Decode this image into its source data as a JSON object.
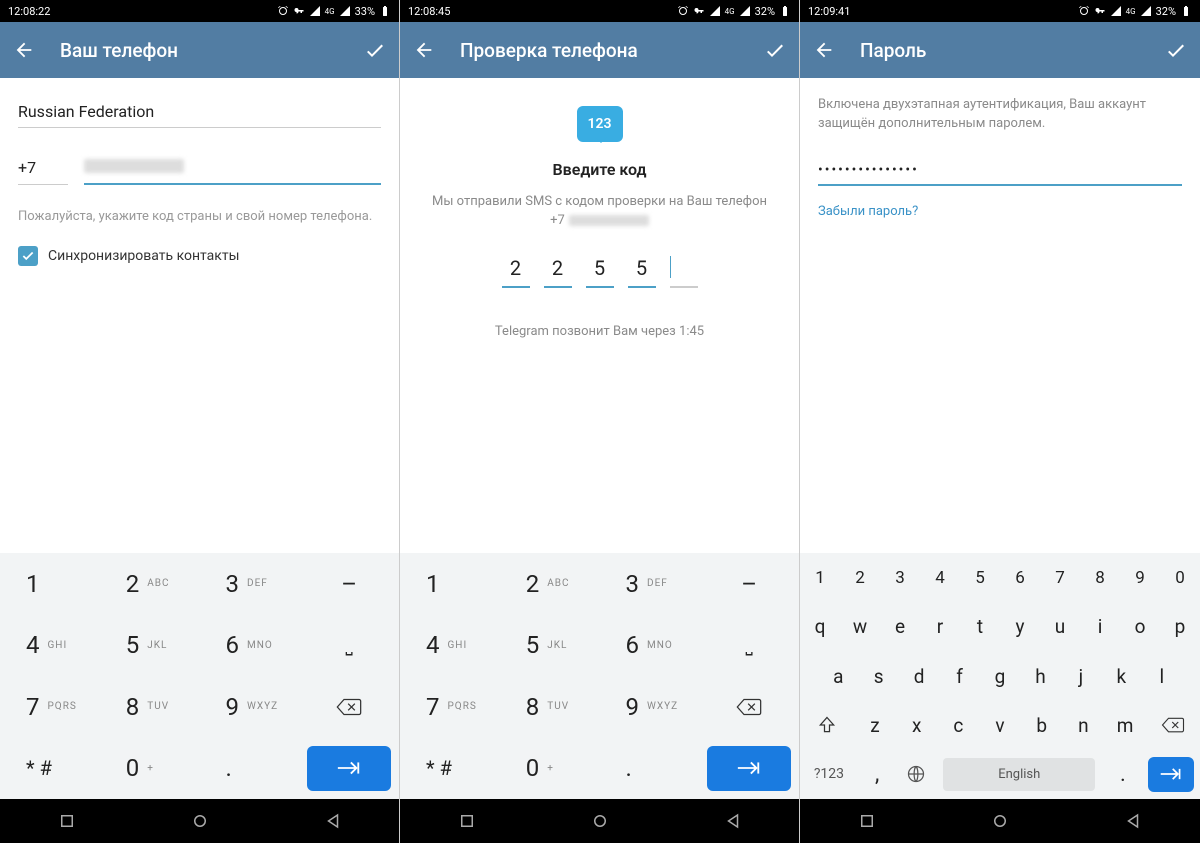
{
  "screen1": {
    "status": {
      "time": "12:08:22",
      "battery": "33%"
    },
    "title": "Ваш телефон",
    "country": "Russian Federation",
    "prefix": "+7",
    "helper": "Пожалуйста, укажите код страны и свой номер телефона.",
    "sync_label": "Синхронизировать контакты",
    "keypad": {
      "keys": [
        {
          "n": "1",
          "s": ""
        },
        {
          "n": "2",
          "s": "ABC"
        },
        {
          "n": "3",
          "s": "DEF"
        },
        {
          "n": "4",
          "s": "GHI"
        },
        {
          "n": "5",
          "s": "JKL"
        },
        {
          "n": "6",
          "s": "MNO"
        },
        {
          "n": "7",
          "s": "PQRS"
        },
        {
          "n": "8",
          "s": "TUV"
        },
        {
          "n": "9",
          "s": "WXYZ"
        },
        {
          "n": "* #",
          "s": ""
        },
        {
          "n": "0",
          "s": "+"
        },
        {
          "n": ".",
          "s": ""
        }
      ],
      "dash": "–",
      "underscore": "⌴"
    }
  },
  "screen2": {
    "status": {
      "time": "12:08:45",
      "battery": "32%"
    },
    "title": "Проверка телефона",
    "bubble": "123",
    "enter_title": "Введите код",
    "sms_text": "Мы отправили SMS с кодом проверки на Ваш телефон",
    "sms_prefix": "+7",
    "code": [
      "2",
      "2",
      "5",
      "5",
      ""
    ],
    "call_text": "Telegram позвонит Вам через 1:45"
  },
  "screen3": {
    "status": {
      "time": "12:09:41",
      "battery": "32%"
    },
    "title": "Пароль",
    "twofa": "Включена двухэтапная аутентификация, Ваш аккаунт защищён дополнительным паролем.",
    "password_mask": "•••••••••••••••",
    "forgot": "Забыли пароль?",
    "qkbd": {
      "nums": [
        "1",
        "2",
        "3",
        "4",
        "5",
        "6",
        "7",
        "8",
        "9",
        "0"
      ],
      "row1": [
        "q",
        "w",
        "e",
        "r",
        "t",
        "y",
        "u",
        "i",
        "o",
        "p"
      ],
      "row2": [
        "a",
        "s",
        "d",
        "f",
        "g",
        "h",
        "j",
        "k",
        "l"
      ],
      "row3": [
        "z",
        "x",
        "c",
        "v",
        "b",
        "n",
        "m"
      ],
      "sym": "?123",
      "comma": ",",
      "period": ".",
      "space": "English"
    }
  }
}
